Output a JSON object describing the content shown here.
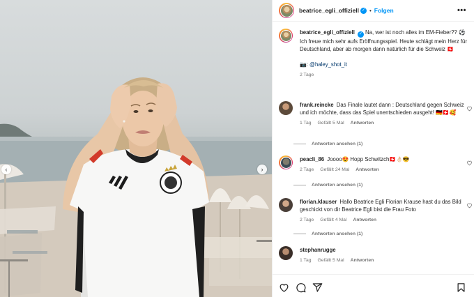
{
  "post": {
    "author": "beatrice_egli_offiziell",
    "follow_label": "Folgen",
    "separator": "•",
    "more_label": "•••",
    "caption_text": "Na, wer ist noch alles im EM-Fieber?? ⚽ Ich freue mich sehr aufs Eröffnungsspiel. Heute schlägt mein Herz für Deutschland, aber ab morgen dann natürlich für die Schweiz 🇨🇭",
    "credit_prefix": "📷: ",
    "credit_link": "@haley_shot_it",
    "age": "2 Tage"
  },
  "comments": [
    {
      "user": "frank.reincke",
      "text": "Das Finale lautet dann : Deutschland gegen Schweiz und ich möchte, dass das Spiel unentschieden ausgeht! 🇩🇪🇨🇭🥰",
      "age": "1 Tag",
      "likes": "Gefällt 5 Mal",
      "reply": "Antworten",
      "view_replies": "Antworten ansehen (1)"
    },
    {
      "user": "peacli_86",
      "text": "Joooo😍 Hopp Schwitzch🇨🇭👌🏻😎",
      "age": "2 Tage",
      "likes": "Gefällt 24 Mal",
      "reply": "Antworten",
      "view_replies": "Antworten ansehen (1)"
    },
    {
      "user": "florian.klauser",
      "text": "Hallo Beatrice Egli Florian Krause hast du das Bild geschickt von dir Beatrice Egli bist die Frau Foto",
      "age": "2 Tage",
      "likes": "Gefällt 4 Mal",
      "reply": "Antworten",
      "view_replies": "Antworten ansehen (1)"
    },
    {
      "user": "stephanrugge",
      "text": "",
      "age": "1 Tag",
      "likes": "Gefällt 5 Mal",
      "reply": "Antworten",
      "view_replies": ""
    }
  ],
  "icons": {
    "like": "heart-icon",
    "comment": "comment-icon",
    "share": "share-icon",
    "save": "bookmark-icon",
    "prev": "chevron-left-icon",
    "next": "chevron-right-icon"
  },
  "colors": {
    "accent": "#0095f6",
    "text": "#262626",
    "muted": "#737373",
    "link": "#00376b"
  }
}
